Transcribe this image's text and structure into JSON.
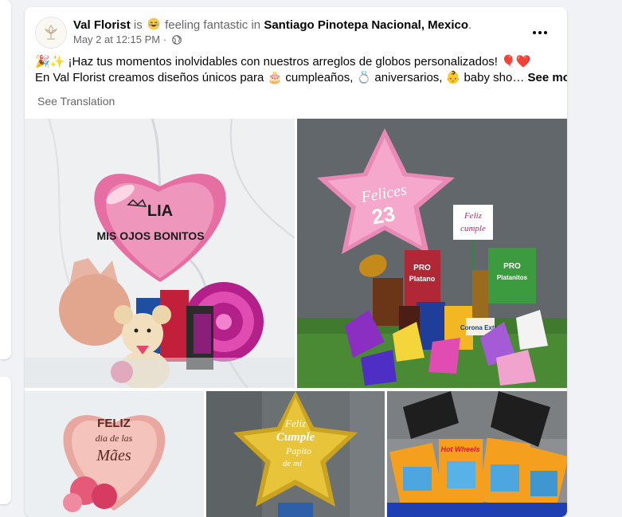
{
  "post": {
    "author": "Val Florist",
    "is_text": "is",
    "feeling_text": "feeling fantastic in",
    "location": "Santiago Pinotepa Nacional, Mexico",
    "location_end": ".",
    "date": "May 2 at 12:15 PM",
    "meta_separator": "·",
    "more_icon": "more-horizontal-icon",
    "line1": "🎉✨ ¡Haz tus momentos inolvidables con nuestros arreglos de globos personalizados! 🎈❤️",
    "line2": "En Val Florist creamos diseños únicos para 🎂 cumpleaños, 💍 aniversarios, 👶 baby sho…",
    "see_more": "See more",
    "see_translation": "See Translation"
  },
  "photos": [
    {
      "balloon_text_1": "LIA",
      "balloon_text_2": "MIS OJOS BONITOS"
    },
    {
      "balloon_text_1": "Felices",
      "balloon_text_2": "23",
      "tag_line_1": "Feliz",
      "tag_line_2": "cumple",
      "snack_1": "PRO",
      "snack_2": "Platano",
      "snack_3": "Platanitos",
      "bottle_label": "Corona Extra"
    },
    {
      "balloon_text_1": "FELIZ",
      "balloon_text_2": "dia de las",
      "balloon_text_3": "Mães"
    },
    {
      "balloon_text_1": "Feliz",
      "balloon_text_2": "Cumple",
      "balloon_text_3": "Papito",
      "balloon_text_4": "de mi"
    },
    {
      "toy_label": "Hot Wheels"
    }
  ]
}
